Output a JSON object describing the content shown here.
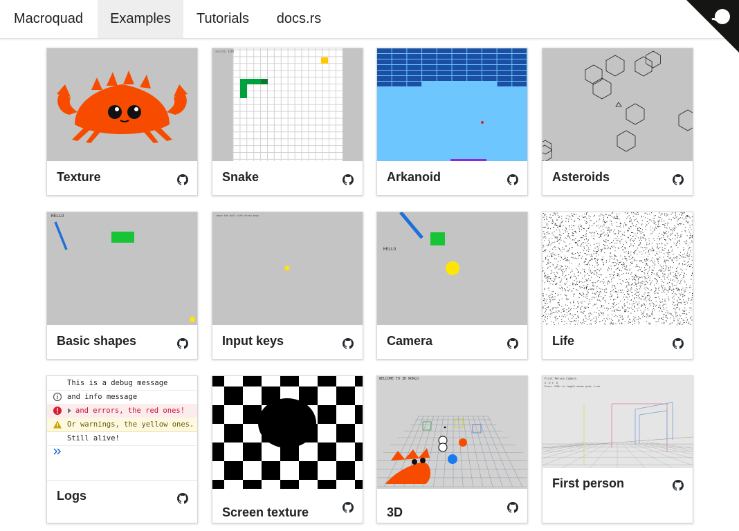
{
  "nav": {
    "items": [
      {
        "label": "Macroquad",
        "active": false
      },
      {
        "label": "Examples",
        "active": true
      },
      {
        "label": "Tutorials",
        "active": false
      },
      {
        "label": "docs.rs",
        "active": false
      }
    ],
    "corner_icon": "github-corner-icon"
  },
  "examples": [
    {
      "title": "Texture",
      "thumbnail": "ferris-crab",
      "link_icon": "github-icon"
    },
    {
      "title": "Snake",
      "thumbnail": "snake-grid",
      "link_icon": "github-icon"
    },
    {
      "title": "Arkanoid",
      "thumbnail": "arkanoid-bricks",
      "link_icon": "github-icon"
    },
    {
      "title": "Asteroids",
      "thumbnail": "asteroids-hexagons",
      "link_icon": "github-icon"
    },
    {
      "title": "Basic shapes",
      "thumbnail": "basic-shapes",
      "thumbnail_text": "HELLO",
      "link_icon": "github-icon"
    },
    {
      "title": "Input keys",
      "thumbnail": "input-keys",
      "thumbnail_text": "move the ball with arrow keys",
      "link_icon": "github-icon"
    },
    {
      "title": "Camera",
      "thumbnail": "camera-shapes",
      "thumbnail_text": "HELLO",
      "link_icon": "github-icon"
    },
    {
      "title": "Life",
      "thumbnail": "life-noise",
      "link_icon": "github-icon"
    },
    {
      "title": "Logs",
      "thumbnail": "log-console",
      "link_icon": "github-icon"
    },
    {
      "title": "Screen texture",
      "thumbnail": "warped-checkerboard",
      "link_icon": "github-icon"
    },
    {
      "title": "3D",
      "thumbnail": "3d-world",
      "thumbnail_text": "WELCOME TO 3D WORLD",
      "link_icon": "github-icon"
    },
    {
      "title": "First person",
      "thumbnail": "first-person-room",
      "thumbnail_text": "First Person Camera",
      "link_icon": "github-icon"
    }
  ],
  "logs": [
    {
      "level": "debug",
      "icon": "",
      "text": "This is a debug message"
    },
    {
      "level": "info",
      "icon": "info-circle-icon",
      "text": "and info message"
    },
    {
      "level": "error",
      "icon": "error-circle-icon",
      "text": "and errors, the red ones!",
      "expandable": true
    },
    {
      "level": "warn",
      "icon": "warning-triangle-icon",
      "text": "Or warnings, the yellow ones."
    },
    {
      "level": "debug",
      "icon": "",
      "text": "Still alive!"
    }
  ],
  "logs_prompt_icon": "double-chevron-right-icon",
  "colors": {
    "error": "#c8102e",
    "warn_bg": "#fdf8e0",
    "error_bg": "#fdecee",
    "card_border": "#d6d6d6",
    "ferris": "#f74c00",
    "snake": "#00a03c",
    "brick": "#1a4fa3",
    "sky": "#6ec6ff",
    "yellow": "#ffe600",
    "green": "#16c436",
    "blue": "#0070e0"
  }
}
